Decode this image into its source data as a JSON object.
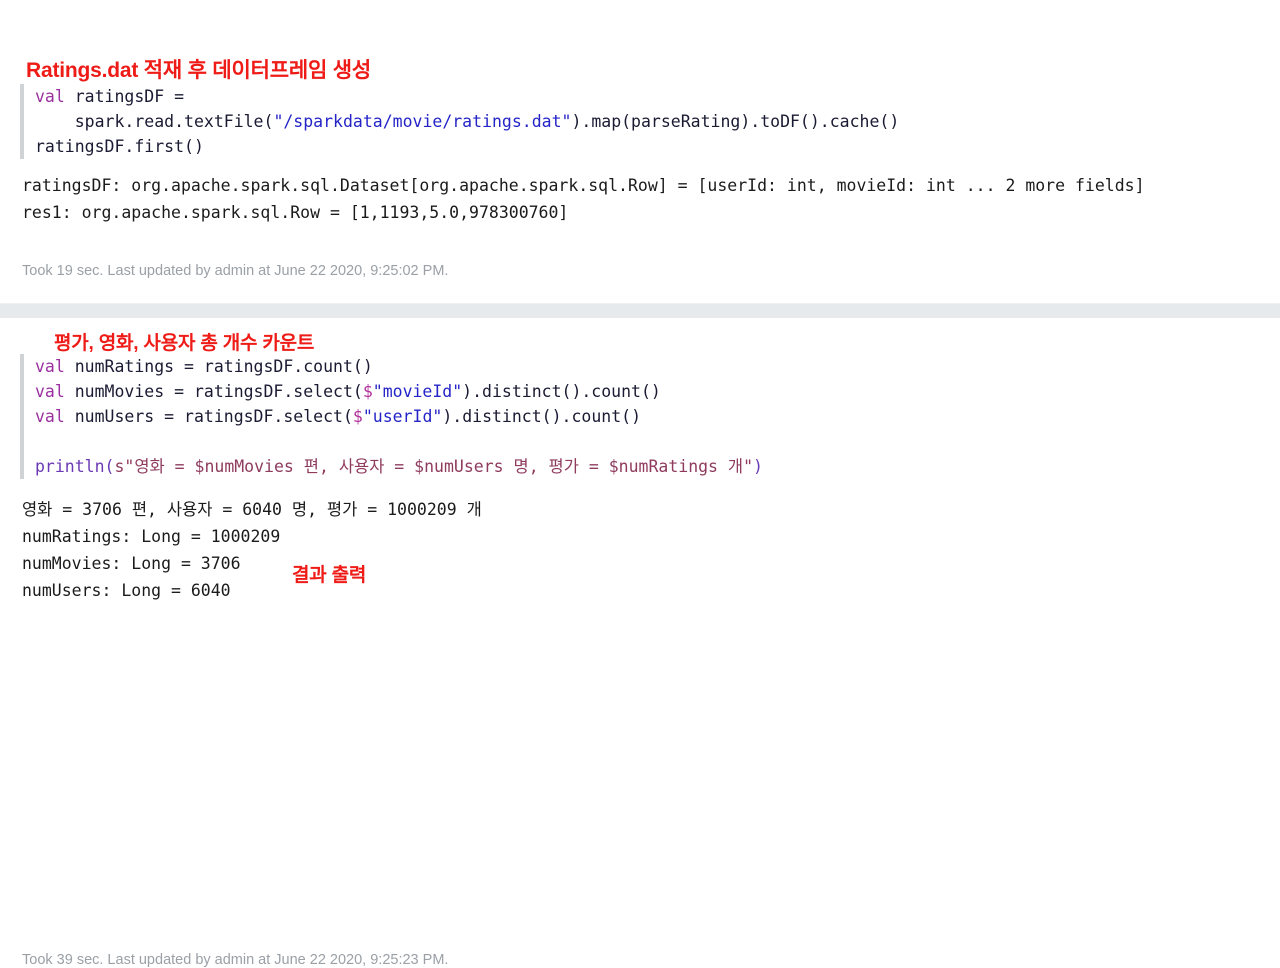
{
  "page": {
    "background_color": "#ffffff",
    "annotation_color": "#ee1b17",
    "divider_color": "#e7eaec",
    "gutter_color": "#cfd3d6"
  },
  "cells": [
    {
      "annotation": "Ratings.dat 적재 후 데이터프레임 생성",
      "code_lines": [
        "val ratingsDF =",
        "    spark.read.textFile(\"/sparkdata/movie/ratings.dat\").map(parseRating).toDF().cache()",
        "ratingsDF.first()"
      ],
      "output_lines": [
        "ratingsDF: org.apache.spark.sql.Dataset[org.apache.spark.sql.Row] = [userId: int, movieId: int ... 2 more fields]",
        "res1: org.apache.spark.sql.Row = [1,1193,5.0,978300760]"
      ],
      "status": "Took 19 sec. Last updated by admin at June 22 2020, 9:25:02 PM.",
      "tokens": {
        "l1_kw": "val",
        "l1_rest": " ratingsDF =",
        "l2_indent": "    ",
        "l2_pre": "spark.read.textFile(",
        "l2_str": "\"/sparkdata/movie/ratings.dat\"",
        "l2_post": ").map(parseRating).toDF().cache()",
        "l3_pre": "ratingsDF.first",
        "l3_caret": "(",
        "l3_post": ")"
      }
    },
    {
      "annotation": "평가, 영화, 사용자 총 개수 카운트",
      "result_annotation": "결과 출력",
      "code_lines": [
        "val numRatings = ratingsDF.count()",
        "val numMovies = ratingsDF.select($\"movieId\").distinct().count()",
        "val numUsers = ratingsDF.select($\"userId\").distinct().count()",
        "",
        "println(s\"영화 = $numMovies 편, 사용자 = $numUsers 명, 평가 = $numRatings 개\")"
      ],
      "output_lines": [
        "영화 = 3706 편, 사용자 = 6040 명, 평가 = 1000209 개",
        "numRatings: Long = 1000209",
        "numMovies: Long = 3706",
        "numUsers: Long = 6040"
      ],
      "status": "Took 39 sec. Last updated by admin at June 22 2020, 9:25:23 PM.",
      "tokens": {
        "c1_kw": "val",
        "c1_rest": " numRatings = ratingsDF.count()",
        "c2_kw": "val",
        "c2_a": " numMovies = ratingsDF.select(",
        "c2_dollar": "$",
        "c2_str": "\"movieId\"",
        "c2_b": ").distinct().count()",
        "c3_kw": "val",
        "c3_a": " numUsers = ratingsDF.select(",
        "c3_dollar": "$",
        "c3_str": "\"userId\"",
        "c3_b": ").distinct().count()",
        "p_fn": "println",
        "p_caret": "(",
        "p_body": "s\"영화 = $numMovies 편, 사용자 = $numUsers 명, 평가 = $numRatings 개\"",
        "p_close": ")"
      }
    }
  ]
}
